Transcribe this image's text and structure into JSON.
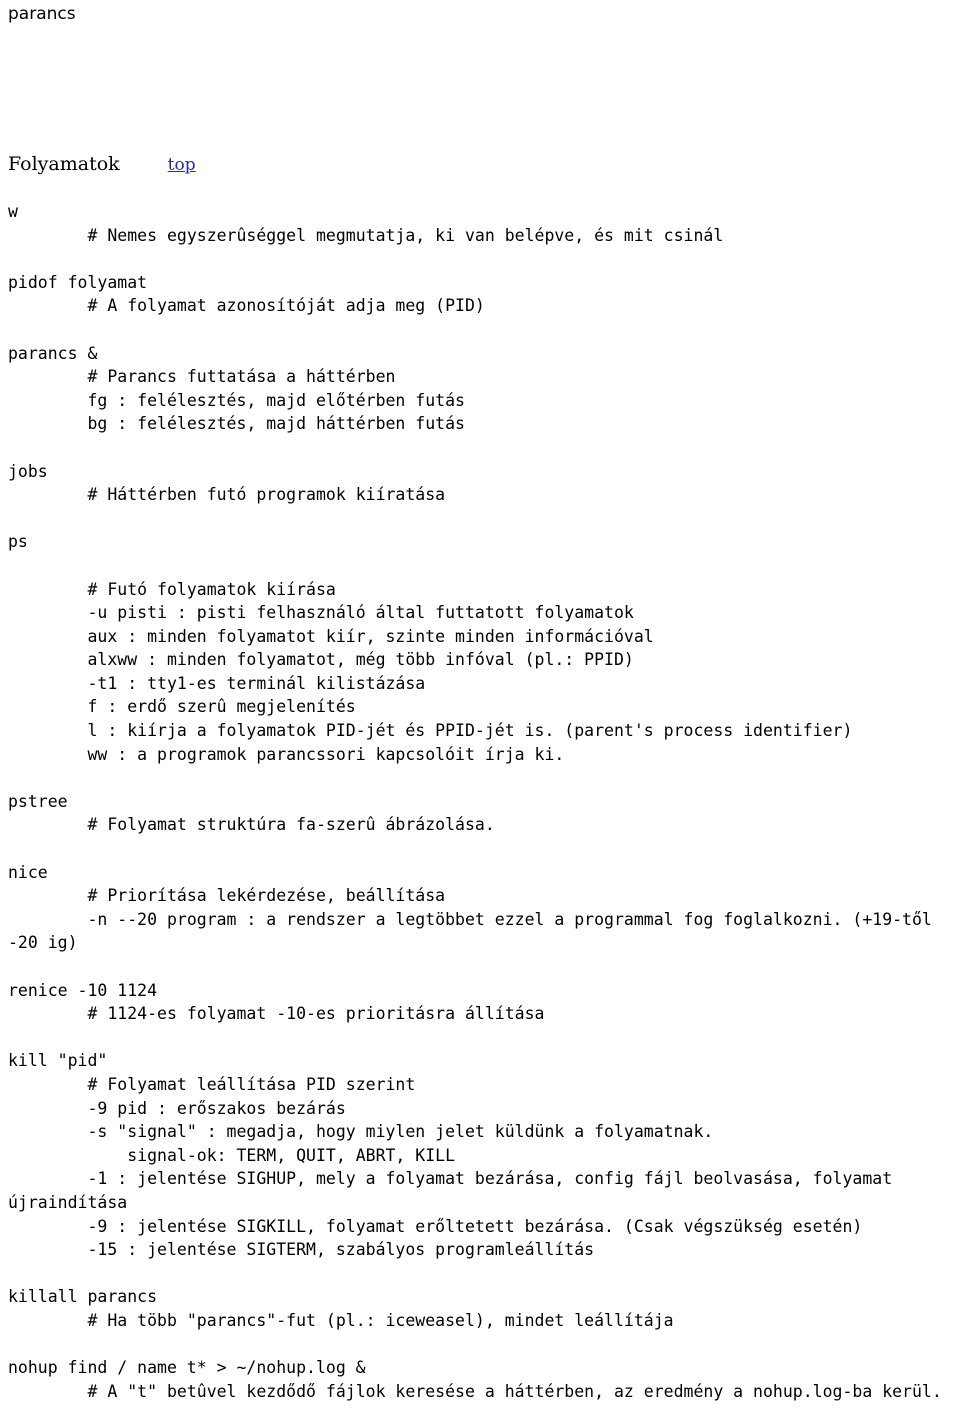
{
  "page": {
    "running_head": "parancs",
    "heading": {
      "title": "Folyamatok",
      "link_label": "top",
      "link_color": "#2b2b9e"
    }
  },
  "listing": {
    "lines": [
      "w",
      "        # Nemes egyszerûséggel megmutatja, ki van belépve, és mit csinál",
      "",
      "pidof folyamat",
      "        # A folyamat azonosítóját adja meg (PID)",
      "",
      "parancs &",
      "        # Parancs futtatása a háttérben",
      "        fg : felélesztés, majd előtérben futás",
      "        bg : felélesztés, majd háttérben futás",
      "",
      "jobs",
      "        # Háttérben futó programok kiíratása",
      "",
      "ps",
      "",
      "        # Futó folyamatok kiírása",
      "        -u pisti : pisti felhasználó által futtatott folyamatok",
      "        aux : minden folyamatot kiír, szinte minden információval",
      "        alxww : minden folyamatot, még több infóval (pl.: PPID)",
      "        -t1 : tty1-es terminál kilistázása",
      "        f : erdő szerû megjelenítés",
      "        l : kiírja a folyamatok PID-jét és PPID-jét is. (parent's process identifier)",
      "        ww : a programok parancssori kapcsolóit írja ki.",
      "",
      "pstree",
      "        # Folyamat struktúra fa-szerû ábrázolása.",
      "",
      "nice",
      "        # Priorítása lekérdezése, beállítása",
      "        -n --20 program : a rendszer a legtöbbet ezzel a programmal fog foglalkozni. (+19-től -20 ig)",
      "",
      "renice -10 1124",
      "        # 1124-es folyamat -10-es prioritásra állítása",
      "",
      "kill \"pid\"",
      "        # Folyamat leállítása PID szerint",
      "        -9 pid : erőszakos bezárás",
      "        -s \"signal\" : megadja, hogy miylen jelet küldünk a folyamatnak.",
      "            signal-ok: TERM, QUIT, ABRT, KILL",
      "        -1 : jelentése SIGHUP, mely a folyamat bezárása, config fájl beolvasása, folyamat újraindítása",
      "        -9 : jelentése SIGKILL, folyamat erőltetett bezárása. (Csak végszükség esetén)",
      "        -15 : jelentése SIGTERM, szabályos programleállítás",
      "",
      "killall parancs",
      "        # Ha több \"parancs\"-fut (pl.: iceweasel), mindet leállítája",
      "",
      "nohup find / name t* > ~/nohup.log &",
      "        # A \"t\" betûvel kezdődő fájlok keresése a háttérben, az eredmény a nohup.log-ba kerül."
    ]
  }
}
